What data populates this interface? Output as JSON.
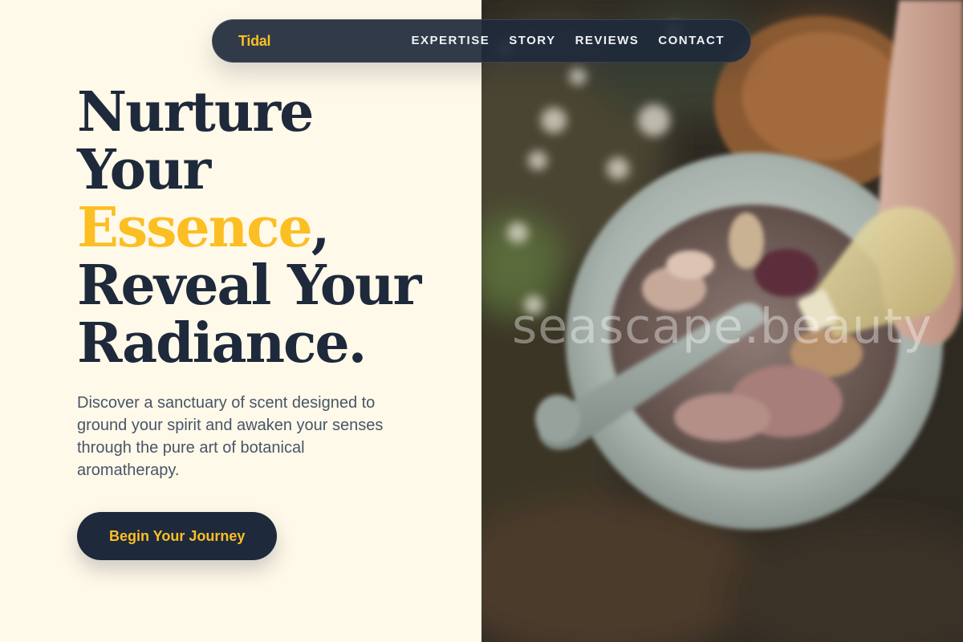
{
  "nav": {
    "brand": "Tidal",
    "links": [
      "EXPERTISE",
      "STORY",
      "REVIEWS",
      "CONTACT"
    ]
  },
  "hero": {
    "headline": {
      "line1": "Nurture",
      "line2": "Your",
      "line3_accent": "Essence",
      "line3_rest": ",",
      "line4": "Reveal Your",
      "line5": "Radiance."
    },
    "subtitle": "Discover a sanctuary of scent designed to ground your spirit and awaken your senses through the pure art of botanical aromatherapy.",
    "cta_label": "Begin Your Journey"
  },
  "photo": {
    "watermark": "seascape.beauty",
    "subject": "mortar-and-pestle-with-oil-bottle"
  },
  "colors": {
    "background": "#fff9e9",
    "navy": "#1e293b",
    "accent": "#fbbf24",
    "body_text": "#475569"
  }
}
